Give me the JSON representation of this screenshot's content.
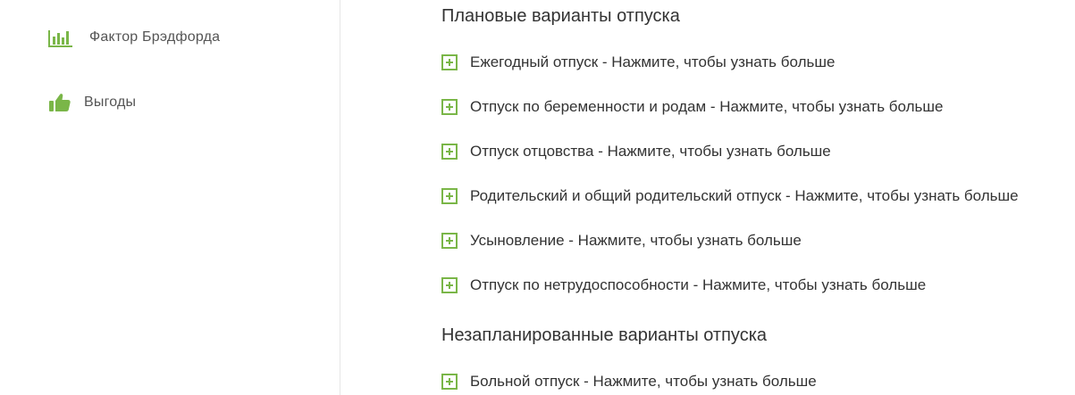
{
  "sidebar": {
    "items": [
      {
        "label": "Фактор Брэдфорда",
        "icon": "bar-chart-icon"
      },
      {
        "label": "Выгоды",
        "icon": "thumbs-up-icon"
      }
    ]
  },
  "main": {
    "planned": {
      "title": "Плановые варианты отпуска",
      "items": [
        "Ежегодный отпуск - Нажмите, чтобы узнать больше",
        "Отпуск по беременности и родам - Нажмите, чтобы узнать больше",
        "Отпуск отцовства - Нажмите, чтобы узнать больше",
        "Родительский и общий родительский отпуск - Нажмите, чтобы узнать больше",
        "Усыновление - Нажмите, чтобы узнать больше",
        "Отпуск по нетрудоспособности - Нажмите, чтобы узнать больше"
      ]
    },
    "unplanned": {
      "title": "Незапланированные варианты отпуска",
      "items": [
        "Больной отпуск - Нажмите, чтобы узнать больше"
      ]
    }
  },
  "colors": {
    "accent": "#7ab648",
    "text": "#333333",
    "divider": "#e6e6e6"
  }
}
